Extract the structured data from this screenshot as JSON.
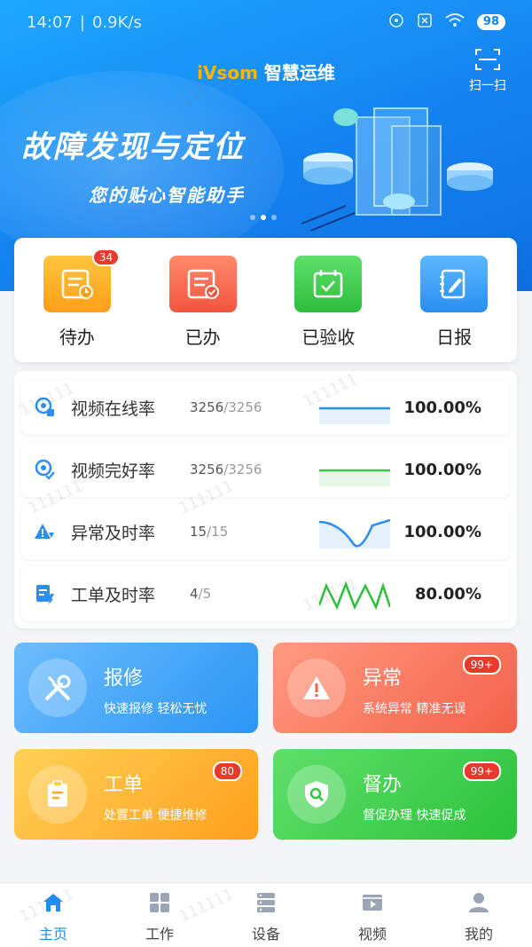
{
  "status_bar": {
    "time": "14:07",
    "speed": "0.9K/s",
    "battery": "98"
  },
  "header": {
    "brand": "iVsom",
    "title": "智慧运维",
    "scan_label": "扫一扫"
  },
  "banner": {
    "title": "故障发现与定位",
    "subtitle": "您的贴心智能助手"
  },
  "quick_actions": [
    {
      "label": "待办",
      "badge": "34",
      "icon": "todo-icon",
      "color": "#ffb020"
    },
    {
      "label": "已办",
      "badge": "",
      "icon": "done-icon",
      "color": "#ff6b55"
    },
    {
      "label": "已验收",
      "badge": "",
      "icon": "accepted-icon",
      "color": "#3dc94b"
    },
    {
      "label": "日报",
      "badge": "",
      "icon": "daily-report-icon",
      "color": "#2f9bf5"
    }
  ],
  "stats": [
    {
      "name": "视频在线率",
      "count": "3256",
      "total": "/3256",
      "percent": "100.00%",
      "icon": "video-online-icon",
      "trend_color": "#2b8ff2",
      "trend_level": 1.0
    },
    {
      "name": "视频完好率",
      "count": "3256",
      "total": "/3256",
      "percent": "100.00%",
      "icon": "video-intact-icon",
      "trend_color": "#3dc94b",
      "trend_level": 1.0
    },
    {
      "name": "异常及时率",
      "count": "15",
      "total": "/15",
      "percent": "100.00%",
      "icon": "warning-icon",
      "trend_color": "#2b8ff2",
      "trend_level": 1.0
    },
    {
      "name": "工单及时率",
      "count": "4",
      "total": "/5",
      "percent": "80.00%",
      "icon": "order-icon",
      "trend_color": "#2bc23a",
      "trend_level": 0.8
    }
  ],
  "tiles": [
    {
      "title": "报修",
      "subtitle": "快速报修  轻松无忧",
      "badge": "",
      "icon": "tools-icon"
    },
    {
      "title": "异常",
      "subtitle": "系统异常  精准无误",
      "badge": "99+",
      "icon": "alert-icon"
    },
    {
      "title": "工单",
      "subtitle": "处置工单  便捷维修",
      "badge": "80",
      "icon": "clipboard-icon"
    },
    {
      "title": "督办",
      "subtitle": "督促办理  快速促成",
      "badge": "99+",
      "icon": "shield-search-icon"
    }
  ],
  "tabs": [
    {
      "label": "主页",
      "icon": "home-icon",
      "active": true
    },
    {
      "label": "工作",
      "icon": "grid-icon",
      "active": false
    },
    {
      "label": "设备",
      "icon": "server-icon",
      "active": false
    },
    {
      "label": "视频",
      "icon": "video-icon",
      "active": false
    },
    {
      "label": "我的",
      "icon": "user-icon",
      "active": false
    }
  ],
  "watermark": "111111",
  "colors": {
    "primary": "#1e8cf0",
    "badge": "#e8392b"
  }
}
